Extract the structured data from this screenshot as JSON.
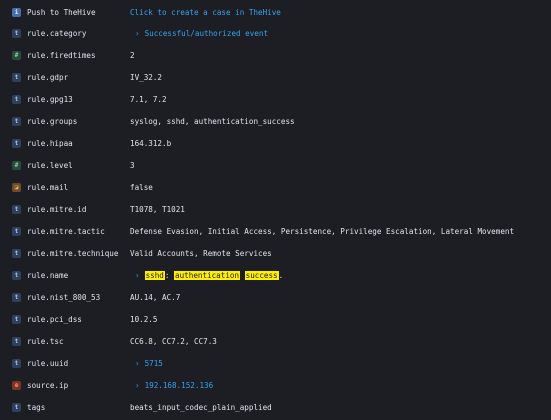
{
  "colors": {
    "background": "#1d1e24",
    "text": "#dfe5ef",
    "link": "#36a2ef",
    "highlight": "#ffef00"
  },
  "fields": [
    {
      "icon": "info-icon",
      "name": "Push to TheHive",
      "value": "Click to create a case in TheHive"
    },
    {
      "icon": "string-type-icon",
      "name": "rule.category",
      "value": "Successful/authorized event"
    },
    {
      "icon": "number-type-icon",
      "name": "rule.firedtimes",
      "value": "2"
    },
    {
      "icon": "string-type-icon",
      "name": "rule.gdpr",
      "value": "IV_32.2"
    },
    {
      "icon": "string-type-icon",
      "name": "rule.gpg13",
      "value": "7.1, 7.2"
    },
    {
      "icon": "string-type-icon",
      "name": "rule.groups",
      "value": "syslog, sshd, authentication_success"
    },
    {
      "icon": "string-type-icon",
      "name": "rule.hipaa",
      "value": "164.312.b"
    },
    {
      "icon": "number-type-icon",
      "name": "rule.level",
      "value": "3"
    },
    {
      "icon": "boolean-type-icon",
      "name": "rule.mail",
      "value": "false"
    },
    {
      "icon": "string-type-icon",
      "name": "rule.mitre.id",
      "value": "T1078, T1021"
    },
    {
      "icon": "string-type-icon",
      "name": "rule.mitre.tactic",
      "value": "Defense Evasion, Initial Access, Persistence, Privilege Escalation, Lateral Movement"
    },
    {
      "icon": "string-type-icon",
      "name": "rule.mitre.technique",
      "value": "Valid Accounts, Remote Services"
    },
    {
      "icon": "string-type-icon",
      "name": "rule.name",
      "value_parts": [
        "sshd",
        ": ",
        "authentication",
        " ",
        "success",
        "."
      ]
    },
    {
      "icon": "string-type-icon",
      "name": "rule.nist_800_53",
      "value": "AU.14, AC.7"
    },
    {
      "icon": "string-type-icon",
      "name": "rule.pci_dss",
      "value": "10.2.5"
    },
    {
      "icon": "string-type-icon",
      "name": "rule.tsc",
      "value": "CC6.8, CC7.2, CC7.3"
    },
    {
      "icon": "string-type-icon",
      "name": "rule.uuid",
      "value": "5715"
    },
    {
      "icon": "ip-type-icon",
      "name": "source.ip",
      "value": "192.168.152.136"
    },
    {
      "icon": "string-type-icon",
      "name": "tags",
      "value": "beats_input_codec_plain_applied"
    }
  ],
  "icon_glyphs": {
    "info": "i",
    "string": "t",
    "number": "#",
    "boolean": "◪",
    "ip": "⊕"
  },
  "chevron": "›"
}
